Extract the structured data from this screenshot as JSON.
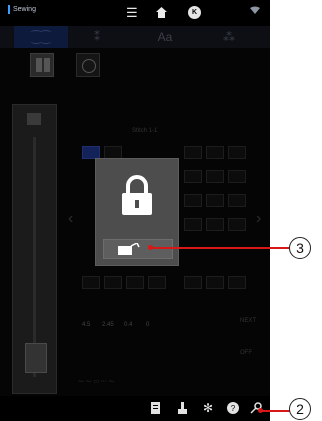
{
  "status_bar": {
    "app_title": "Sewing",
    "icons": [
      "menu-icon",
      "home-icon",
      "ok-icon",
      "wifi-icon"
    ],
    "ok_badge": "K"
  },
  "tabs": [
    {
      "label": "",
      "icon": "stitch-type-icon"
    },
    {
      "label": "",
      "icon": "decorative-stitch-icon"
    },
    {
      "label": "Aa",
      "icon": "character-icon"
    },
    {
      "label": "",
      "icon": "stitch-edit-icon"
    }
  ],
  "stitch_info": {
    "heading": "Stitch 1-1"
  },
  "params": [
    {
      "label": "",
      "value": "4.5"
    },
    {
      "label": "",
      "value": "2.45"
    },
    {
      "label": "",
      "value": "0.4"
    },
    {
      "label": "",
      "value": "0"
    }
  ],
  "side_labels": {
    "top": "NEXT",
    "bottom": "OFF"
  },
  "bottom_bar": {
    "icons": [
      "notebook-icon",
      "presser-foot-icon",
      "settings-gear-icon",
      "help-icon",
      "lock-key-icon"
    ]
  },
  "lock_dialog": {
    "icon": "padlock-icon",
    "button_icon": "unlock-key-icon"
  },
  "callouts": [
    {
      "number": "3"
    },
    {
      "number": "2"
    }
  ],
  "colors": {
    "callout_red": "#d81818",
    "accent_blue": "#3aa0ff",
    "dialog_gray": "#4d4d4d"
  }
}
